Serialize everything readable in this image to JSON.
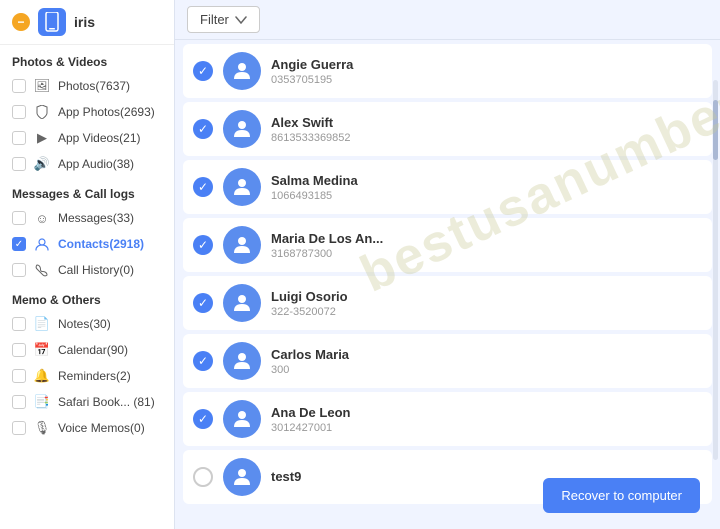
{
  "sidebar": {
    "device_name": "iris",
    "sections": [
      {
        "title": "Photos & Videos",
        "items": [
          {
            "id": "photos",
            "label": "Photos(7637)",
            "icon": "🖼",
            "checked": false
          },
          {
            "id": "app-photos",
            "label": "App Photos(2693)",
            "icon": "★",
            "checked": false
          },
          {
            "id": "app-videos",
            "label": "App Videos(21)",
            "icon": "▶",
            "checked": false
          },
          {
            "id": "app-audio",
            "label": "App Audio(38)",
            "icon": "🔊",
            "checked": false
          }
        ]
      },
      {
        "title": "Messages & Call logs",
        "items": [
          {
            "id": "messages",
            "label": "Messages(33)",
            "icon": "☺",
            "checked": false
          },
          {
            "id": "contacts",
            "label": "Contacts(2918)",
            "icon": "👤",
            "checked": true,
            "active": true
          },
          {
            "id": "call-history",
            "label": "Call History(0)",
            "icon": "📞",
            "checked": false
          }
        ]
      },
      {
        "title": "Memo & Others",
        "items": [
          {
            "id": "notes",
            "label": "Notes(30)",
            "icon": "📄",
            "checked": false
          },
          {
            "id": "calendar",
            "label": "Calendar(90)",
            "icon": "📅",
            "checked": false
          },
          {
            "id": "reminders",
            "label": "Reminders(2)",
            "icon": "🔔",
            "checked": false
          },
          {
            "id": "safari",
            "label": "Safari Book... (81)",
            "icon": "📑",
            "checked": false
          },
          {
            "id": "voice-memos",
            "label": "Voice Memos(0)",
            "icon": "🎙",
            "checked": false
          }
        ]
      }
    ]
  },
  "toolbar": {
    "filter_label": "Filter"
  },
  "contacts": [
    {
      "name": "Angie Guerra",
      "phone": "0353705195",
      "checked": true
    },
    {
      "name": "Alex Swift",
      "phone": "8613533369852",
      "checked": true
    },
    {
      "name": "Salma Medina",
      "phone": "1066493185",
      "checked": true
    },
    {
      "name": "Maria De Los An...",
      "phone": "3168787300",
      "checked": true
    },
    {
      "name": "Luigi Osorio",
      "phone": "322-3520072",
      "checked": true
    },
    {
      "name": "Carlos Maria",
      "phone": "300",
      "checked": true
    },
    {
      "name": "Ana De Leon",
      "phone": "3012427001",
      "checked": true
    },
    {
      "name": "test9",
      "phone": "",
      "checked": false
    }
  ],
  "buttons": {
    "recover": "Recover to computer"
  },
  "watermark": "bestusanumber"
}
